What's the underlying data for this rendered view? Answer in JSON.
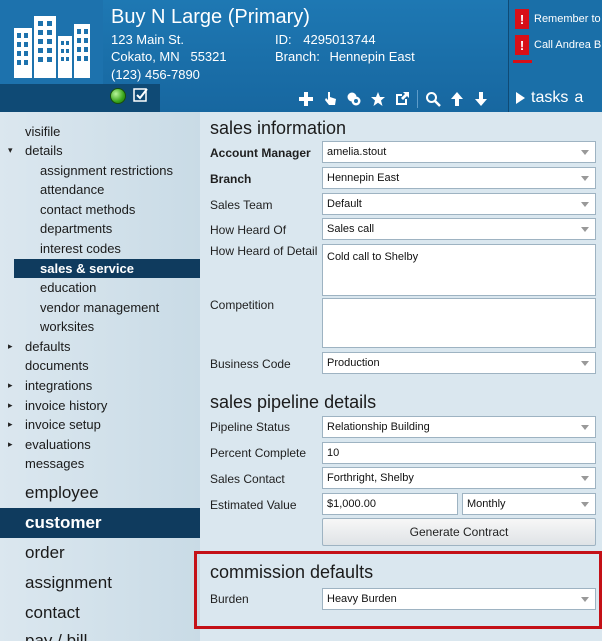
{
  "header": {
    "company_name": "Buy N Large (Primary)",
    "address_line1": "123 Main St.",
    "address_line2": "Cokato, MN   55321",
    "phone": "(123) 456-7890",
    "id_label": "ID:",
    "id_value": "4295013744",
    "branch_label": "Branch:",
    "branch_value": "Hennepin East",
    "status_dot_color": "#3aa51b",
    "toolbar_icons": [
      "plus-icon",
      "pointer-icon",
      "merge-icon",
      "star-icon",
      "external-link-icon",
      "search-icon",
      "arrow-up-icon",
      "arrow-down-icon"
    ]
  },
  "alerts": [
    {
      "text": "Remember to"
    },
    {
      "text": "Call Andrea B"
    }
  ],
  "tasks": {
    "label": "tasks",
    "overflow": "a"
  },
  "sidebar": {
    "items": [
      {
        "label": "visifile"
      },
      {
        "label": "details",
        "arrow": "▾"
      },
      {
        "label": "assignment restrictions"
      },
      {
        "label": "attendance"
      },
      {
        "label": "contact methods"
      },
      {
        "label": "departments"
      },
      {
        "label": "interest codes"
      },
      {
        "label": "sales & service"
      },
      {
        "label": "education"
      },
      {
        "label": "vendor management"
      },
      {
        "label": "worksites"
      },
      {
        "label": "defaults",
        "arrow": "▸"
      },
      {
        "label": "documents"
      },
      {
        "label": "integrations",
        "arrow": "▸"
      },
      {
        "label": "invoice history",
        "arrow": "▸"
      },
      {
        "label": "invoice setup",
        "arrow": "▸"
      },
      {
        "label": "evaluations",
        "arrow": "▸"
      },
      {
        "label": "messages"
      }
    ],
    "big_items": [
      {
        "label": "employee"
      },
      {
        "label": "customer"
      },
      {
        "label": "order"
      },
      {
        "label": "assignment"
      },
      {
        "label": "contact"
      },
      {
        "label": "pay / bill"
      }
    ]
  },
  "sales_information": {
    "title": "sales information",
    "account_manager": {
      "label": "Account Manager",
      "value": "amelia.stout"
    },
    "branch": {
      "label": "Branch",
      "value": "Hennepin East"
    },
    "sales_team": {
      "label": "Sales Team",
      "value": "Default"
    },
    "how_heard_of": {
      "label": "How Heard Of",
      "value": "Sales call"
    },
    "how_heard_detail": {
      "label": "How Heard of Detail",
      "value": "Cold call to Shelby"
    },
    "competition": {
      "label": "Competition",
      "value": ""
    },
    "business_code": {
      "label": "Business Code",
      "value": "Production"
    }
  },
  "pipeline": {
    "title": "sales pipeline details",
    "status": {
      "label": "Pipeline Status",
      "value": "Relationship Building"
    },
    "percent": {
      "label": "Percent Complete",
      "value": "10"
    },
    "contact": {
      "label": "Sales Contact",
      "value": "Forthright, Shelby"
    },
    "estimated": {
      "label": "Estimated Value",
      "value": "$1,000.00",
      "period": "Monthly"
    },
    "generate_button": "Generate Contract"
  },
  "commission": {
    "title": "commission defaults",
    "burden": {
      "label": "Burden",
      "value": "Heavy Burden"
    },
    "highlight_color": "#c41017"
  }
}
